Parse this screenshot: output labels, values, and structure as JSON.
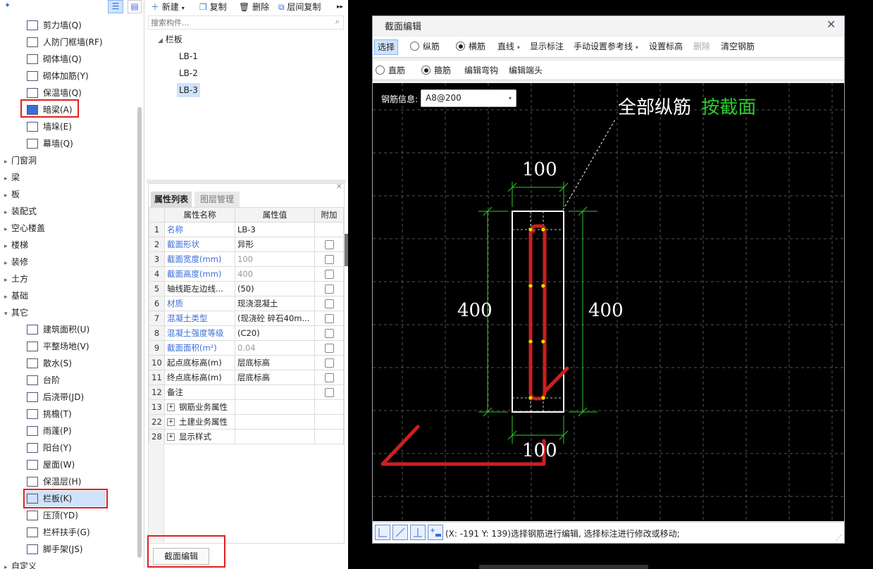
{
  "left_tree": {
    "items": [
      {
        "label": "剪力墙(Q)",
        "icon": "shear-wall-icon"
      },
      {
        "label": "人防门框墙(RF)",
        "icon": "civil-defense-door-icon"
      },
      {
        "label": "砌体墙(Q)",
        "icon": "masonry-wall-icon"
      },
      {
        "label": "砌体加筋(Y)",
        "icon": "masonry-rebar-icon"
      },
      {
        "label": "保温墙(Q)",
        "icon": "insulation-wall-icon"
      },
      {
        "label": "暗梁(A)",
        "icon": "hidden-beam-icon"
      },
      {
        "label": "墙垛(E)",
        "icon": "wall-pier-icon"
      },
      {
        "label": "幕墙(Q)",
        "icon": "curtain-wall-icon"
      }
    ],
    "categories": [
      "门窗洞",
      "梁",
      "板",
      "装配式",
      "空心楼盖",
      "楼梯",
      "装修",
      "土方",
      "基础",
      "其它"
    ],
    "other_items": [
      {
        "label": "建筑面积(U)",
        "icon": "building-area-icon"
      },
      {
        "label": "平整场地(V)",
        "icon": "site-leveling-icon"
      },
      {
        "label": "散水(S)",
        "icon": "apron-icon"
      },
      {
        "label": "台阶",
        "icon": "steps-icon"
      },
      {
        "label": "后浇带(JD)",
        "icon": "post-cast-strip-icon"
      },
      {
        "label": "挑檐(T)",
        "icon": "cornice-icon"
      },
      {
        "label": "雨蓬(P)",
        "icon": "canopy-icon"
      },
      {
        "label": "阳台(Y)",
        "icon": "balcony-icon"
      },
      {
        "label": "屋面(W)",
        "icon": "roof-icon"
      },
      {
        "label": "保温层(H)",
        "icon": "insulation-layer-icon"
      },
      {
        "label": "栏板(K)",
        "icon": "parapet-icon"
      },
      {
        "label": "压顶(YD)",
        "icon": "coping-icon"
      },
      {
        "label": "栏杆扶手(G)",
        "icon": "railing-icon"
      },
      {
        "label": "脚手架(JS)",
        "icon": "scaffold-icon"
      }
    ],
    "cut_label": "自定义"
  },
  "mid_toolbar": {
    "new_label": "新建",
    "copy_label": "复制",
    "delete_label": "删除",
    "floor_copy_label": "层间复制"
  },
  "search": {
    "placeholder": "搜索构件..."
  },
  "component_tree": {
    "root": "栏板",
    "items": [
      "LB-1",
      "LB-2",
      "LB-3"
    ]
  },
  "props": {
    "tab_active": "属性列表",
    "tab_inactive": "图层管理",
    "headers": [
      "属性名称",
      "属性值",
      "附加"
    ],
    "rows": [
      {
        "n": "1",
        "name": "名称",
        "value": "LB-3",
        "style": "blue",
        "val_style": "",
        "cb": false
      },
      {
        "n": "2",
        "name": "截面形状",
        "value": "异形",
        "style": "blue",
        "val_style": "",
        "cb": true
      },
      {
        "n": "3",
        "name": "截面宽度(mm)",
        "value": "100",
        "style": "blue",
        "val_style": "gray",
        "cb": true
      },
      {
        "n": "4",
        "name": "截面高度(mm)",
        "value": "400",
        "style": "blue",
        "val_style": "gray",
        "cb": true
      },
      {
        "n": "5",
        "name": "轴线距左边线...",
        "value": "(50)",
        "style": "",
        "val_style": "",
        "cb": true
      },
      {
        "n": "6",
        "name": "材质",
        "value": "现浇混凝土",
        "style": "blue",
        "val_style": "",
        "cb": true
      },
      {
        "n": "7",
        "name": "混凝土类型",
        "value": "(现浇砼 碎石40m...",
        "style": "blue",
        "val_style": "",
        "cb": true
      },
      {
        "n": "8",
        "name": "混凝土强度等级",
        "value": "(C20)",
        "style": "blue",
        "val_style": "",
        "cb": true
      },
      {
        "n": "9",
        "name": "截面面积(m²)",
        "value": "0.04",
        "style": "blue",
        "val_style": "gray",
        "cb": true
      },
      {
        "n": "10",
        "name": "起点底标高(m)",
        "value": "层底标高",
        "style": "",
        "val_style": "",
        "cb": true
      },
      {
        "n": "11",
        "name": "终点底标高(m)",
        "value": "层底标高",
        "style": "",
        "val_style": "",
        "cb": true
      },
      {
        "n": "12",
        "name": "备注",
        "value": "",
        "style": "",
        "val_style": "",
        "cb": true
      },
      {
        "n": "13",
        "name": "钢筋业务属性",
        "value": "",
        "style": "",
        "val_style": "",
        "cb": false,
        "group": true
      },
      {
        "n": "22",
        "name": "土建业务属性",
        "value": "",
        "style": "",
        "val_style": "",
        "cb": false,
        "group": true
      },
      {
        "n": "28",
        "name": "显示样式",
        "value": "",
        "style": "",
        "val_style": "",
        "cb": false,
        "group": true
      }
    ]
  },
  "edit_section_button": "截面编辑",
  "dialog": {
    "title": "截面编辑",
    "toolbar1": {
      "select": "选择",
      "longitudinal": "纵筋",
      "transverse": "横筋",
      "line": "直线",
      "show_dims": "显示标注",
      "manual_ref": "手动设置参考线",
      "set_elevation": "设置标高",
      "delete": "删除",
      "clear_rebar": "清空钢筋"
    },
    "toolbar2": {
      "straight": "直筋",
      "stirrup": "箍筋",
      "edit_hook": "编辑弯钩",
      "edit_end": "编辑端头"
    },
    "rebar_info_label": "钢筋信息:",
    "rebar_info_value": "A8@200",
    "annot_all": "全部纵筋",
    "annot_by": "按截面",
    "dim_top": "100",
    "dim_bottom": "100",
    "dim_left": "400",
    "dim_right": "400",
    "status_text": "(X: -191 Y: 139)选择钢筋进行编辑, 选择标注进行修改或移动;",
    "colors": {
      "green": "#2ecc2e",
      "red": "#cc1f1f",
      "white": "#ffffff"
    }
  }
}
